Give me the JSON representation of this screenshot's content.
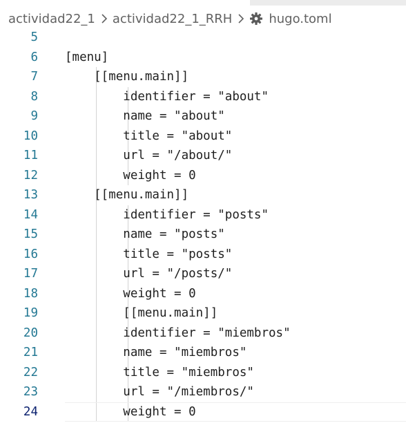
{
  "breadcrumb": {
    "items": [
      "actividad22_1",
      "actividad22_1_RRH",
      "hugo.toml"
    ],
    "file_icon": "gear-icon"
  },
  "editor": {
    "active_line": 24,
    "lines": [
      {
        "num": "5",
        "text": ""
      },
      {
        "num": "6",
        "text": "[menu]"
      },
      {
        "num": "7",
        "text": "    [[menu.main]]"
      },
      {
        "num": "8",
        "text": "        identifier = \"about\""
      },
      {
        "num": "9",
        "text": "        name = \"about\""
      },
      {
        "num": "10",
        "text": "        title = \"about\""
      },
      {
        "num": "11",
        "text": "        url = \"/about/\""
      },
      {
        "num": "12",
        "text": "        weight = 0"
      },
      {
        "num": "13",
        "text": "    [[menu.main]]"
      },
      {
        "num": "14",
        "text": "        identifier = \"posts\""
      },
      {
        "num": "15",
        "text": "        name = \"posts\""
      },
      {
        "num": "16",
        "text": "        title = \"posts\""
      },
      {
        "num": "17",
        "text": "        url = \"/posts/\""
      },
      {
        "num": "18",
        "text": "        weight = 0"
      },
      {
        "num": "19",
        "text": "        [[menu.main]]"
      },
      {
        "num": "20",
        "text": "        identifier = \"miembros\""
      },
      {
        "num": "21",
        "text": "        name = \"miembros\""
      },
      {
        "num": "22",
        "text": "        title = \"miembros\""
      },
      {
        "num": "23",
        "text": "        url = \"/miembros/\""
      },
      {
        "num": "24",
        "text": "        weight = 0"
      }
    ]
  },
  "colors": {
    "line_number": "#237893",
    "line_number_active": "#0b216f",
    "code_text": "#1f1f1f",
    "indent_guide": "#d3d3d3"
  }
}
